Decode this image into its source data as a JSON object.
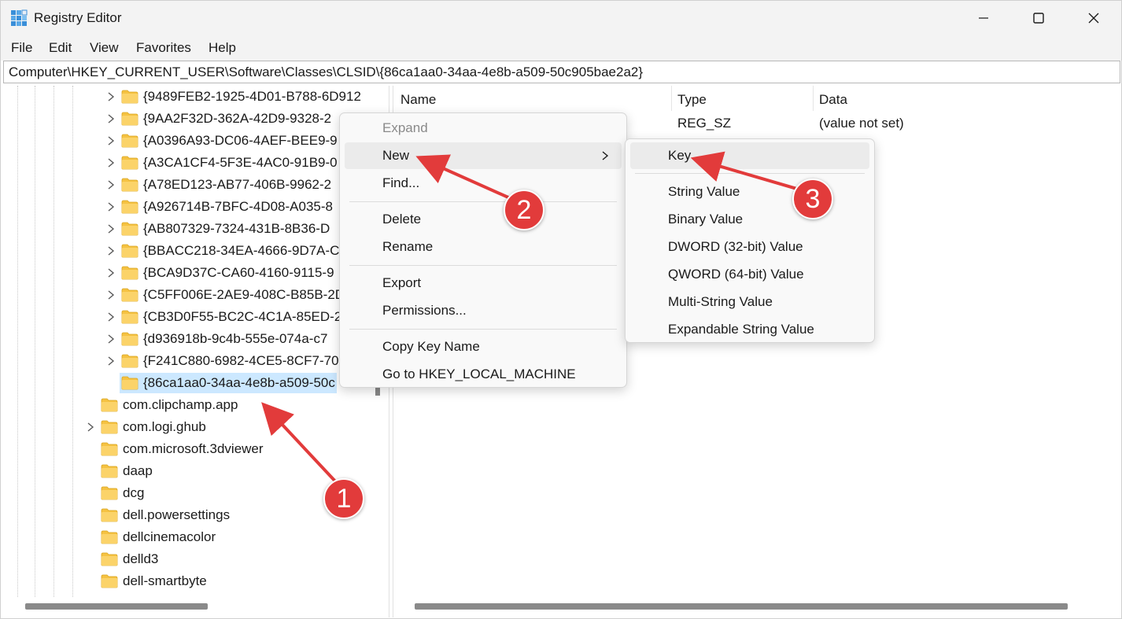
{
  "window": {
    "title": "Registry Editor",
    "controls": {
      "minimize": "minimize",
      "maximize": "maximize",
      "close": "close"
    }
  },
  "menubar": [
    "File",
    "Edit",
    "View",
    "Favorites",
    "Help"
  ],
  "address": "Computer\\HKEY_CURRENT_USER\\Software\\Classes\\CLSID\\{86ca1aa0-34aa-4e8b-a509-50c905bae2a2}",
  "tree": {
    "items": [
      {
        "label": "{9489FEB2-1925-4D01-B788-6D912",
        "expandable": true,
        "selected": false
      },
      {
        "label": "{9AA2F32D-362A-42D9-9328-2",
        "expandable": true,
        "selected": false
      },
      {
        "label": "{A0396A93-DC06-4AEF-BEE9-9",
        "expandable": true,
        "selected": false
      },
      {
        "label": "{A3CA1CF4-5F3E-4AC0-91B9-0",
        "expandable": true,
        "selected": false
      },
      {
        "label": "{A78ED123-AB77-406B-9962-2",
        "expandable": true,
        "selected": false
      },
      {
        "label": "{A926714B-7BFC-4D08-A035-8",
        "expandable": true,
        "selected": false
      },
      {
        "label": "{AB807329-7324-431B-8B36-D",
        "expandable": true,
        "selected": false
      },
      {
        "label": "{BBACC218-34EA-4666-9D7A-C",
        "expandable": true,
        "selected": false
      },
      {
        "label": "{BCA9D37C-CA60-4160-9115-9",
        "expandable": true,
        "selected": false
      },
      {
        "label": "{C5FF006E-2AE9-408C-B85B-2D",
        "expandable": true,
        "selected": false
      },
      {
        "label": "{CB3D0F55-BC2C-4C1A-85ED-2",
        "expandable": true,
        "selected": false
      },
      {
        "label": "{d936918b-9c4b-555e-074a-c7",
        "expandable": true,
        "selected": false
      },
      {
        "label": "{F241C880-6982-4CE5-8CF7-70",
        "expandable": true,
        "selected": false
      },
      {
        "label": "{86ca1aa0-34aa-4e8b-a509-50c",
        "expandable": false,
        "selected": true
      },
      {
        "label": "com.clipchamp.app",
        "expandable": false,
        "selected": false
      },
      {
        "label": "com.logi.ghub",
        "expandable": true,
        "selected": false
      },
      {
        "label": "com.microsoft.3dviewer",
        "expandable": false,
        "selected": false
      },
      {
        "label": "daap",
        "expandable": false,
        "selected": false
      },
      {
        "label": "dcg",
        "expandable": false,
        "selected": false
      },
      {
        "label": "dell.powersettings",
        "expandable": false,
        "selected": false
      },
      {
        "label": "dellcinemacolor",
        "expandable": false,
        "selected": false
      },
      {
        "label": "delld3",
        "expandable": false,
        "selected": false
      },
      {
        "label": "dell-smartbyte",
        "expandable": false,
        "selected": false
      }
    ]
  },
  "values": {
    "columns": {
      "name": "Name",
      "type": "Type",
      "data": "Data"
    },
    "rows": [
      {
        "type": "REG_SZ",
        "data": "(value not set)"
      }
    ]
  },
  "context_menu": {
    "expand": "Expand",
    "new": "New",
    "find": "Find...",
    "delete": "Delete",
    "rename": "Rename",
    "export": "Export",
    "permissions": "Permissions...",
    "copy_key_name": "Copy Key Name",
    "goto": "Go to HKEY_LOCAL_MACHINE"
  },
  "submenu": {
    "key": "Key",
    "string_value": "String Value",
    "binary_value": "Binary Value",
    "dword_value": "DWORD (32-bit) Value",
    "qword_value": "QWORD (64-bit) Value",
    "multistring_value": "Multi-String Value",
    "expandable_string_value": "Expandable String Value"
  },
  "annotations": {
    "badge1": "1",
    "badge2": "2",
    "badge3": "3",
    "color": "#e23b3b"
  },
  "colors": {
    "selection": "#cce8ff",
    "folder": "#f5c242",
    "hover": "#ebebeb"
  }
}
